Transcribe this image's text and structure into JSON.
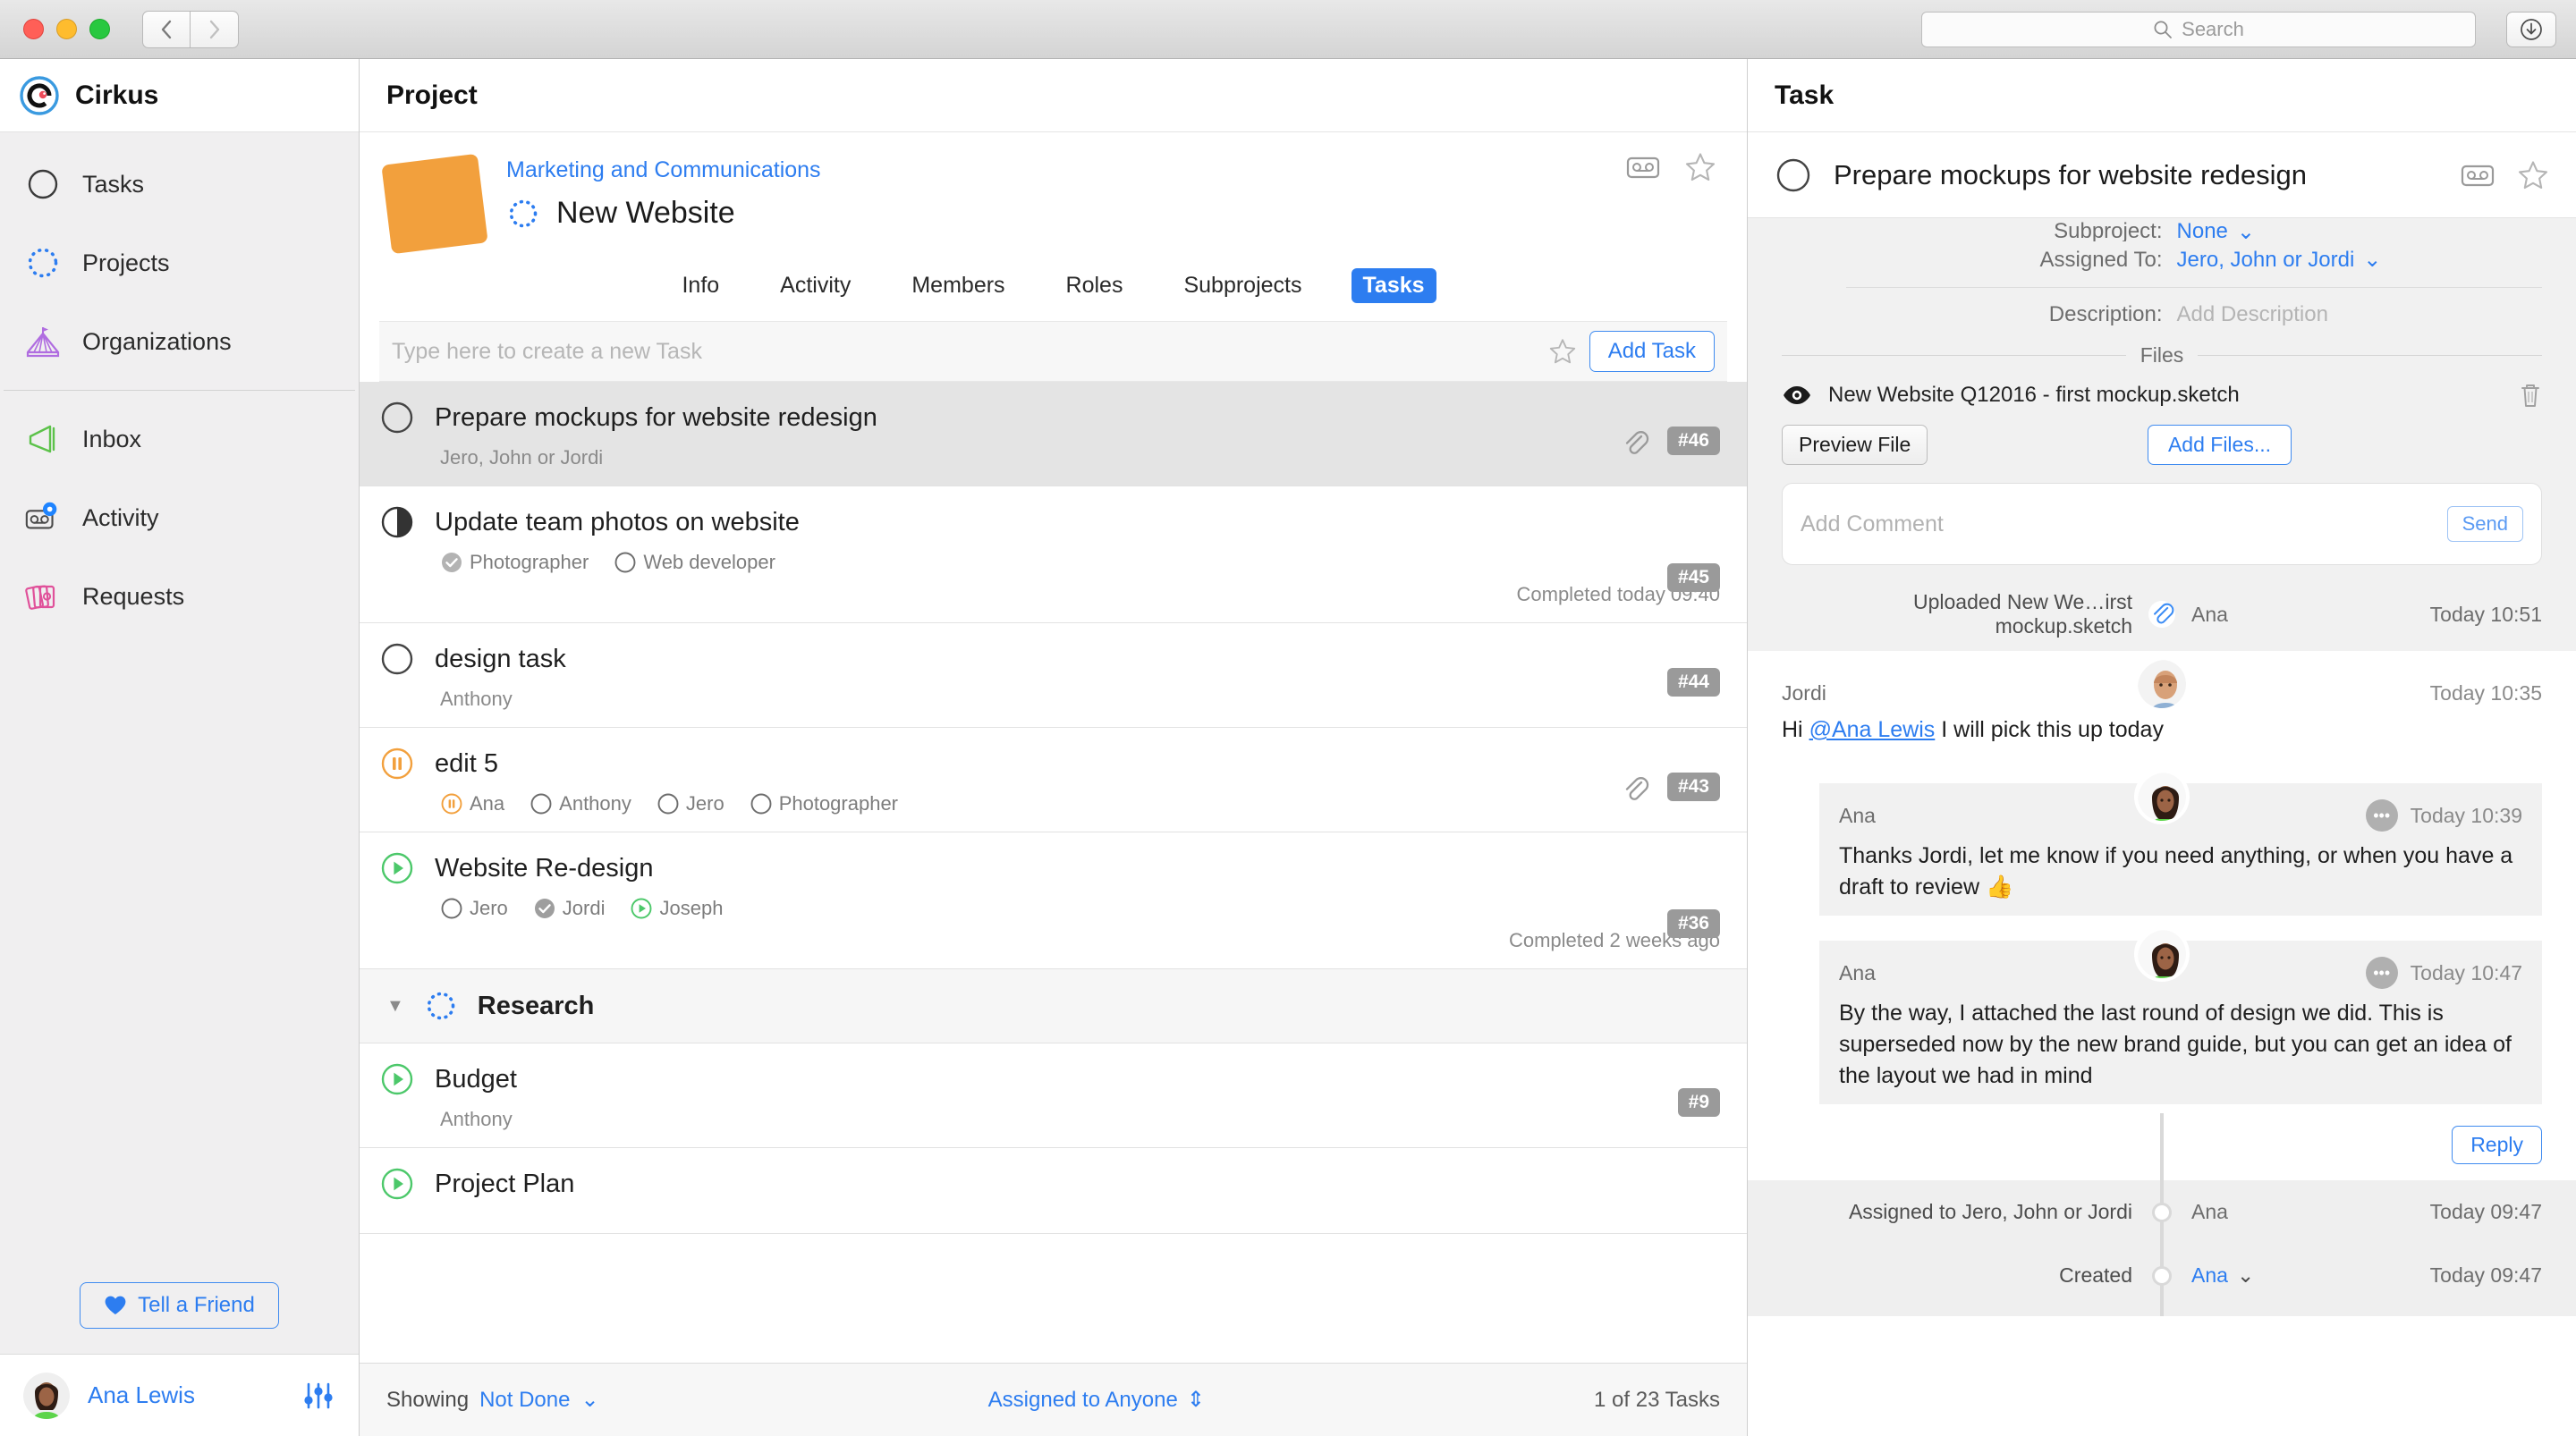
{
  "titlebar": {
    "back_label": "‹",
    "forward_label": "›",
    "search_placeholder": "Search",
    "download_icon": "download-icon"
  },
  "sidebar": {
    "brand": "Cirkus",
    "items": [
      {
        "label": "Tasks",
        "icon": "circle-outline-icon"
      },
      {
        "label": "Projects",
        "icon": "dotted-circle-icon"
      },
      {
        "label": "Organizations",
        "icon": "circus-tent-icon"
      },
      {
        "label": "Inbox",
        "icon": "megaphone-icon"
      },
      {
        "label": "Activity",
        "icon": "activity-icon"
      },
      {
        "label": "Requests",
        "icon": "cards-icon"
      }
    ],
    "tell_a_friend": "Tell a Friend",
    "user_name": "Ana Lewis"
  },
  "center": {
    "panel_title": "Project",
    "org_link": "Marketing and Communications",
    "project_title": "New Website",
    "tabs": [
      {
        "label": "Info",
        "active": false
      },
      {
        "label": "Activity",
        "active": false
      },
      {
        "label": "Members",
        "active": false
      },
      {
        "label": "Roles",
        "active": false
      },
      {
        "label": "Subprojects",
        "active": false
      },
      {
        "label": "Tasks",
        "active": true
      }
    ],
    "new_task_placeholder": "Type here to create a new Task",
    "add_task_label": "Add Task",
    "tasks": [
      {
        "title": "Prepare mockups for website redesign",
        "assignee_text": "Jero, John or Jordi",
        "roles": [],
        "badge": "#46",
        "has_clip": true,
        "status": "open",
        "selected": true,
        "completed_text": ""
      },
      {
        "title": "Update team photos on website",
        "assignee_text": "",
        "roles": [
          {
            "label": "Photographer",
            "state": "done"
          },
          {
            "label": "Web developer",
            "state": "open"
          }
        ],
        "badge": "#45",
        "has_clip": false,
        "status": "half",
        "selected": false,
        "completed_text": "Completed today 09:40"
      },
      {
        "title": "design task",
        "assignee_text": "Anthony",
        "roles": [],
        "badge": "#44",
        "has_clip": false,
        "status": "open",
        "selected": false,
        "completed_text": ""
      },
      {
        "title": "edit 5",
        "assignee_text": "",
        "roles": [
          {
            "label": "Ana",
            "state": "paused"
          },
          {
            "label": "Anthony",
            "state": "open"
          },
          {
            "label": "Jero",
            "state": "open"
          },
          {
            "label": "Photographer",
            "state": "open"
          }
        ],
        "badge": "#43",
        "has_clip": true,
        "status": "paused",
        "selected": false,
        "completed_text": ""
      },
      {
        "title": "Website Re-design",
        "assignee_text": "",
        "roles": [
          {
            "label": "Jero",
            "state": "open"
          },
          {
            "label": "Jordi",
            "state": "done"
          },
          {
            "label": "Joseph",
            "state": "running"
          }
        ],
        "badge": "#36",
        "has_clip": false,
        "status": "running",
        "selected": false,
        "completed_text": "Completed 2 weeks ago"
      }
    ],
    "group": {
      "title": "Research",
      "caret": "▼"
    },
    "group_tasks": [
      {
        "title": "Budget",
        "assignee_text": "Anthony",
        "badge": "#9",
        "status": "running"
      },
      {
        "title": "Project Plan",
        "assignee_text": "",
        "badge": "",
        "status": "running"
      }
    ],
    "statusbar": {
      "showing_label": "Showing",
      "filter_value": "Not Done",
      "filter_caret": "⌄",
      "assigned_value": "Assigned to Anyone",
      "assigned_caret": "⇕",
      "count_text": "1 of 23 Tasks"
    }
  },
  "task_panel": {
    "panel_title": "Task",
    "task_title": "Prepare mockups for website redesign",
    "fields": [
      {
        "label": "Subproject:",
        "value": "None",
        "caret": "⌄",
        "muted": false
      },
      {
        "label": "Assigned To:",
        "value": "Jero, John or Jordi",
        "caret": "⌄",
        "muted": false
      },
      {
        "label": "Description:",
        "value": "Add Description",
        "caret": "",
        "muted": true
      }
    ],
    "files_heading": "Files",
    "file_name": "New Website Q12016 - first mockup.sketch",
    "preview_file_label": "Preview File",
    "add_files_label": "Add Files...",
    "comment_placeholder": "Add Comment",
    "send_label": "Send",
    "events_top": [
      {
        "left": "Uploaded New We…irst mockup.sketch",
        "who": "Ana",
        "when": "Today 10:51",
        "icon": "paperclip-icon"
      }
    ],
    "messages": [
      {
        "author": "Jordi",
        "when": "Today 10:35",
        "body_prefix": "Hi ",
        "mention": "@Ana Lewis",
        "body_suffix": " I will pick this up today",
        "shaded": false,
        "indent": false,
        "avatar": "jordi"
      },
      {
        "author": "Ana",
        "when": "Today 10:39",
        "body_prefix": "Thanks Jordi, let me know if you need anything, or when you have a draft to review 👍",
        "mention": "",
        "body_suffix": "",
        "shaded": true,
        "indent": true,
        "avatar": "ana"
      },
      {
        "author": "Ana",
        "when": "Today 10:47",
        "body_prefix": "By the way, I attached the last round of design we did. This is superseded now by the new brand guide, but you can get an idea of the layout we had in mind",
        "mention": "",
        "body_suffix": "",
        "shaded": true,
        "indent": true,
        "avatar": "ana"
      }
    ],
    "reply_label": "Reply",
    "events_bottom": [
      {
        "left": "Assigned to Jero, John or Jordi",
        "who": "Ana",
        "when": "Today 09:47",
        "link": false,
        "caret": ""
      },
      {
        "left": "Created",
        "who": "Ana",
        "when": "Today 09:47",
        "link": true,
        "caret": "⌄"
      }
    ]
  },
  "colors": {
    "accent_blue": "#2d7df0",
    "orange": "#f2a03d",
    "green": "#4cc86a",
    "purple": "#b06de0",
    "pink": "#e0519a"
  }
}
